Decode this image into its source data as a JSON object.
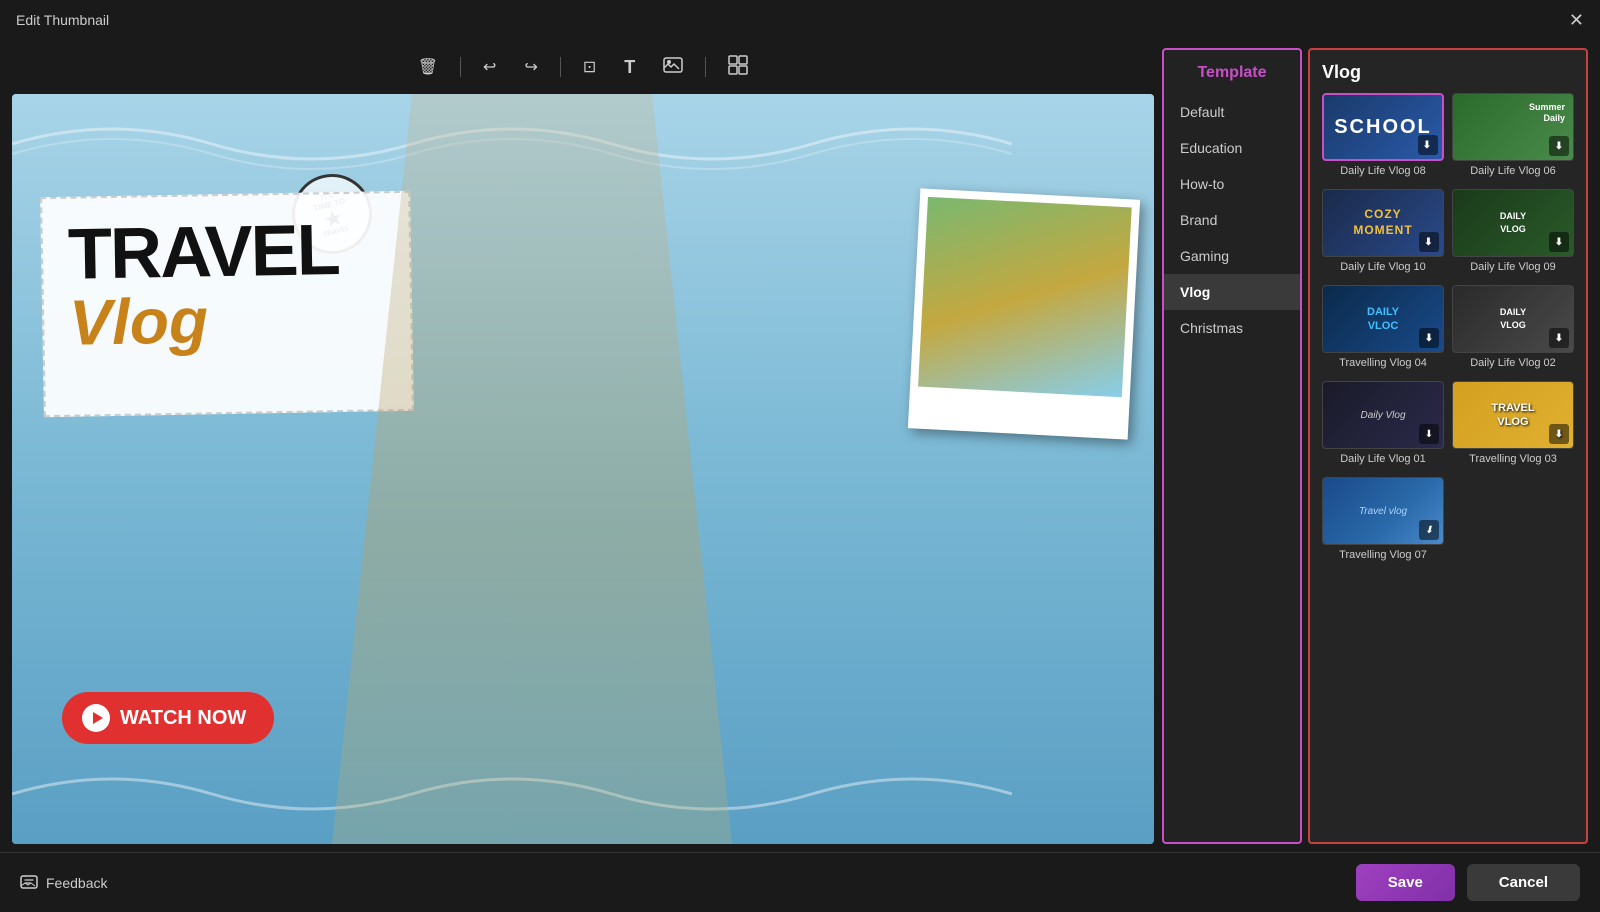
{
  "titleBar": {
    "title": "Edit Thumbnail",
    "closeLabel": "✕"
  },
  "toolbar": {
    "deleteIcon": "🗑",
    "undoIcon": "↩",
    "redoIcon": "↪",
    "cropIcon": "⊡",
    "textIcon": "T",
    "imageIcon": "🖼",
    "layoutIcon": "⊞"
  },
  "sidebar": {
    "header": "Template",
    "items": [
      {
        "label": "Default",
        "active": false
      },
      {
        "label": "Education",
        "active": false
      },
      {
        "label": "How-to",
        "active": false
      },
      {
        "label": "Brand",
        "active": false
      },
      {
        "label": "Gaming",
        "active": false
      },
      {
        "label": "Vlog",
        "active": true
      },
      {
        "label": "Christmas",
        "active": false
      }
    ]
  },
  "templatePanel": {
    "sectionTitle": "Vlog",
    "templates": [
      {
        "label": "Daily Life Vlog 08",
        "style": "school",
        "text": "SCHOOL"
      },
      {
        "label": "Daily Life Vlog 06",
        "style": "summer",
        "text": "Summer Daily"
      },
      {
        "label": "Daily Life Vlog 10",
        "style": "cozy",
        "text": "COZY MOMENT"
      },
      {
        "label": "Daily Life Vlog 09",
        "style": "daily9",
        "text": "DAILY VLOG"
      },
      {
        "label": "Travelling Vlog 04",
        "style": "daily4",
        "text": "DAILY VLOC"
      },
      {
        "label": "Daily Life Vlog 02",
        "style": "daily2",
        "text": "DAILY VLOG"
      },
      {
        "label": "Daily Life Vlog 01",
        "style": "daily1",
        "text": "Daily Vlog"
      },
      {
        "label": "Travelling Vlog 03",
        "style": "travel3",
        "text": "TRAVEL VLOG"
      },
      {
        "label": "Travelling Vlog 07",
        "style": "travel7",
        "text": "Travel vlog"
      }
    ]
  },
  "canvas": {
    "travelText": "TRAVEL",
    "vlogText": "Vlog",
    "watchNow": "WATCH NOW",
    "stampText": "TIME TO TRAVEL"
  },
  "bottomBar": {
    "feedbackIcon": "⊡",
    "feedbackLabel": "Feedback",
    "saveLabel": "Save",
    "cancelLabel": "Cancel"
  }
}
